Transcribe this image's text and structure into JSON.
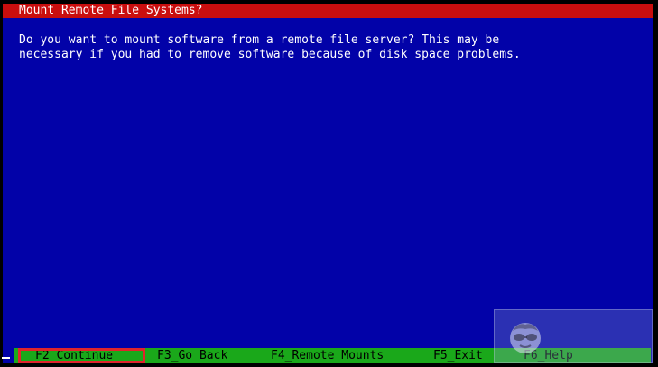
{
  "window": {
    "title": "Mount Remote File Systems?"
  },
  "message": {
    "lines": [
      "Do you want to mount software from a remote file server? This may be",
      "necessary if you had to remove software because of disk space problems."
    ]
  },
  "function_keys": [
    {
      "label": "F2_Continue",
      "selected": true
    },
    {
      "label": "F3_Go Back",
      "selected": false
    },
    {
      "label": "F4_Remote Mounts",
      "selected": false
    },
    {
      "label": "F5_Exit",
      "selected": false
    },
    {
      "label": "F6_Help",
      "selected": false
    }
  ],
  "colors": {
    "background": "#0202a8",
    "title_bar": "#c90e0e",
    "key_bar": "#1aa81a",
    "selection_outline": "#e0242c",
    "text": "#ffffff"
  },
  "icons": {
    "watermark": "avatar-icon"
  }
}
